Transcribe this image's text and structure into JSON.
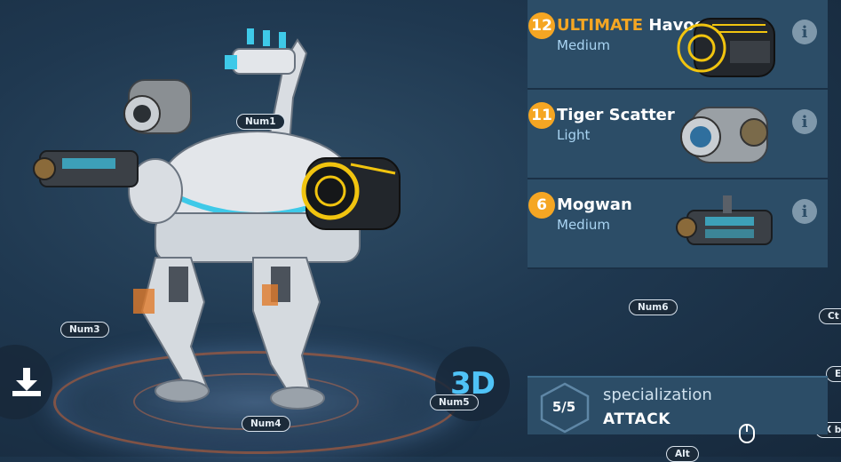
{
  "weapons": [
    {
      "level": "12",
      "prefix": "ULTIMATE",
      "name": "Havoc",
      "class": "Medium",
      "icon": "havoc-weapon-icon"
    },
    {
      "level": "11",
      "prefix": "",
      "name": "Tiger Scatter",
      "class": "Light",
      "icon": "tiger-scatter-weapon-icon"
    },
    {
      "level": "6",
      "prefix": "",
      "name": "Mogwan",
      "class": "Medium",
      "icon": "mogwan-weapon-icon"
    }
  ],
  "info_glyph": "i",
  "specialization": {
    "count": "5/5",
    "label": "specialization",
    "value": "ATTACK"
  },
  "view_3d_label": "3D",
  "key_hints": {
    "num1": "Num1",
    "num3": "Num3",
    "num4": "Num4",
    "num5": "Num5",
    "num6": "Num6",
    "ctrl": "Ct",
    "e": "E",
    "x": "X bu",
    "alt": "Alt"
  },
  "colors": {
    "accent": "#f5a623",
    "panel": "#2c4d67",
    "class_text": "#a9d4f2",
    "view3d": "#4fc3f7"
  }
}
